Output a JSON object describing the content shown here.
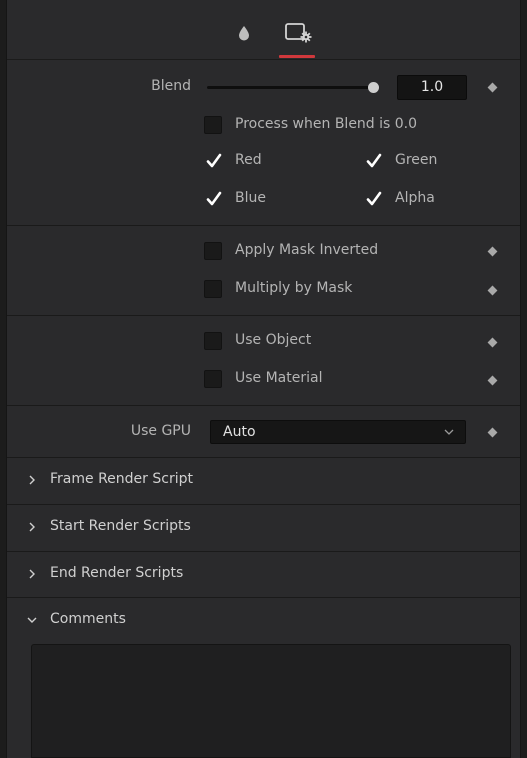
{
  "tabs": [
    {
      "icon": "droplet-icon"
    },
    {
      "icon": "settings-icon",
      "active": true
    }
  ],
  "blend": {
    "label": "Blend",
    "value": "1.0",
    "slider_fraction": 1.0
  },
  "checkboxes": {
    "process_when_blend": {
      "label": "Process when Blend is 0.0",
      "checked": false
    },
    "red": {
      "label": "Red",
      "checked": true
    },
    "green": {
      "label": "Green",
      "checked": true
    },
    "blue": {
      "label": "Blue",
      "checked": true
    },
    "alpha": {
      "label": "Alpha",
      "checked": true
    },
    "apply_mask_inverted": {
      "label": "Apply Mask Inverted",
      "checked": false
    },
    "multiply_by_mask": {
      "label": "Multiply by Mask",
      "checked": false
    },
    "use_object": {
      "label": "Use Object",
      "checked": false
    },
    "use_material": {
      "label": "Use Material",
      "checked": false
    }
  },
  "gpu": {
    "label": "Use GPU",
    "value": "Auto"
  },
  "sections": {
    "frame_render_script": "Frame Render Script",
    "start_render_scripts": "Start Render Scripts",
    "end_render_scripts": "End Render Scripts",
    "comments": "Comments"
  },
  "colors": {
    "accent": "#d0383c",
    "panel": "#2a2a2c"
  }
}
